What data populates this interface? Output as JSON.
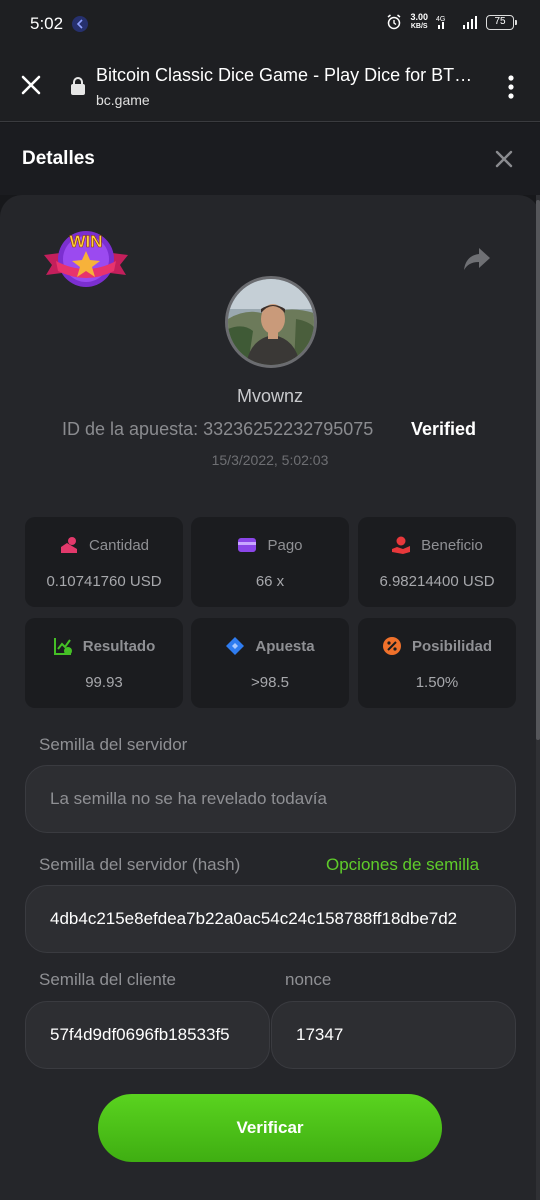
{
  "status_bar": {
    "time": "5:02",
    "speed_value": "3.00",
    "speed_unit": "KB/S",
    "network": "4G",
    "battery": "75"
  },
  "browser": {
    "title": "Bitcoin Classic Dice Game - Play Dice for BT…",
    "url": "bc.game",
    "icons": [
      "close-icon",
      "lock-icon",
      "more-vert-icon"
    ]
  },
  "modal": {
    "title": "Detalles",
    "close_icon": "close-icon"
  },
  "bet": {
    "badge_text": "WIN",
    "username": "Mvownz",
    "bet_id_label": "ID de la apuesta: 33236252232795075",
    "verified_label": "Verified",
    "date": "15/3/2022, 5:02:03"
  },
  "stats": [
    {
      "label": "Cantidad",
      "value": "0.10741760 USD",
      "icon": "coins-icon",
      "color": "#e2396b"
    },
    {
      "label": "Pago",
      "value": "66 x",
      "icon": "wallet-icon",
      "color": "#8b46e8"
    },
    {
      "label": "Beneficio",
      "value": "6.98214400 USD",
      "icon": "hand-coin-icon",
      "color": "#e8383b"
    },
    {
      "label": "Resultado",
      "value": "99.93",
      "icon": "chart-check-icon",
      "color": "#45c026"
    },
    {
      "label": "Apuesta",
      "value": ">98.5",
      "icon": "ticket-icon",
      "color": "#2f7cf0"
    },
    {
      "label": "Posibilidad",
      "value": "1.50%",
      "icon": "percent-icon",
      "color": "#f0712b"
    }
  ],
  "server_seed": {
    "label": "Semilla del servidor",
    "placeholder": "La semilla no se ha revelado todavía"
  },
  "server_hash": {
    "label": "Semilla del servidor (hash)",
    "options_link": "Opciones de semilla",
    "value": "4db4c215e8efdea7b22a0ac54c24c158788ff18dbe7d2"
  },
  "client_seed": {
    "label": "Semilla del cliente",
    "value": "57f4d9df0696fb18533f5"
  },
  "nonce": {
    "label": "nonce",
    "value": "17347"
  },
  "verify_button": "Verificar"
}
